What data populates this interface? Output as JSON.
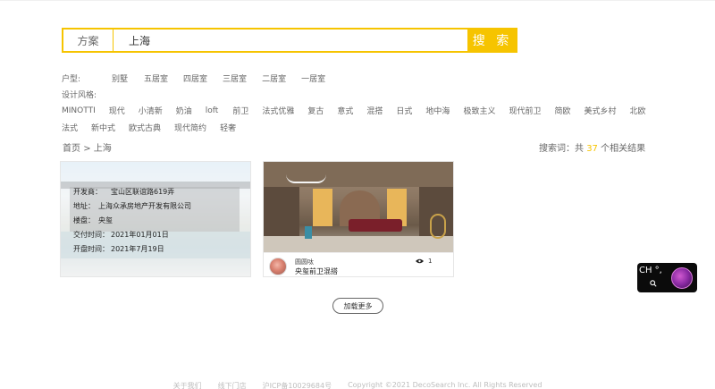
{
  "search": {
    "type_label": "方案",
    "value": "上海",
    "button_label": "搜 索"
  },
  "filters": {
    "house_type_label": "户型:",
    "house_types": [
      "别墅",
      "五居室",
      "四居室",
      "三居室",
      "二居室",
      "一居室"
    ],
    "style_label": "设计风格:",
    "styles_row1": [
      "MINOTTI",
      "现代",
      "小清新",
      "奶油",
      "loft",
      "前卫",
      "法式优雅",
      "复古",
      "意式",
      "混搭",
      "日式",
      "地中海",
      "极致主义",
      "现代前卫",
      "简欧",
      "美式乡村",
      "北欧"
    ],
    "styles_row2": [
      "法式",
      "新中式",
      "欧式古典",
      "现代简约",
      "轻奢"
    ]
  },
  "breadcrumb": {
    "home": "首页",
    "separator": ">",
    "current": "上海"
  },
  "result": {
    "prefix": "搜索词：共",
    "count": "37",
    "suffix": "个相关结果"
  },
  "card1": {
    "developer_label": "开发商：",
    "developer": "宝山区联谊路619弄",
    "address_label": "地址：",
    "address": "上海众承房地产开发有限公司",
    "building_label": "楼盘：",
    "building": "央玺",
    "delivery_label": "交付时间：",
    "delivery": "2021年01月01日",
    "opening_label": "开盘时间：",
    "opening": "2021年7月19日"
  },
  "card2": {
    "author": "圆圆呔",
    "title": "央玺前卫混搭",
    "views": "1"
  },
  "load_more": "加载更多",
  "widget": {
    "lang": "CH °,"
  },
  "footer": {
    "about": "关于我们",
    "entry": "线下门店",
    "icp": "沪ICP备10029684号",
    "copyright": "Copyright ©2021 DecoSearch Inc. All Rights Reserved"
  },
  "colors": {
    "accent": "#f6c400",
    "text": "#333333",
    "muted": "#666666"
  }
}
